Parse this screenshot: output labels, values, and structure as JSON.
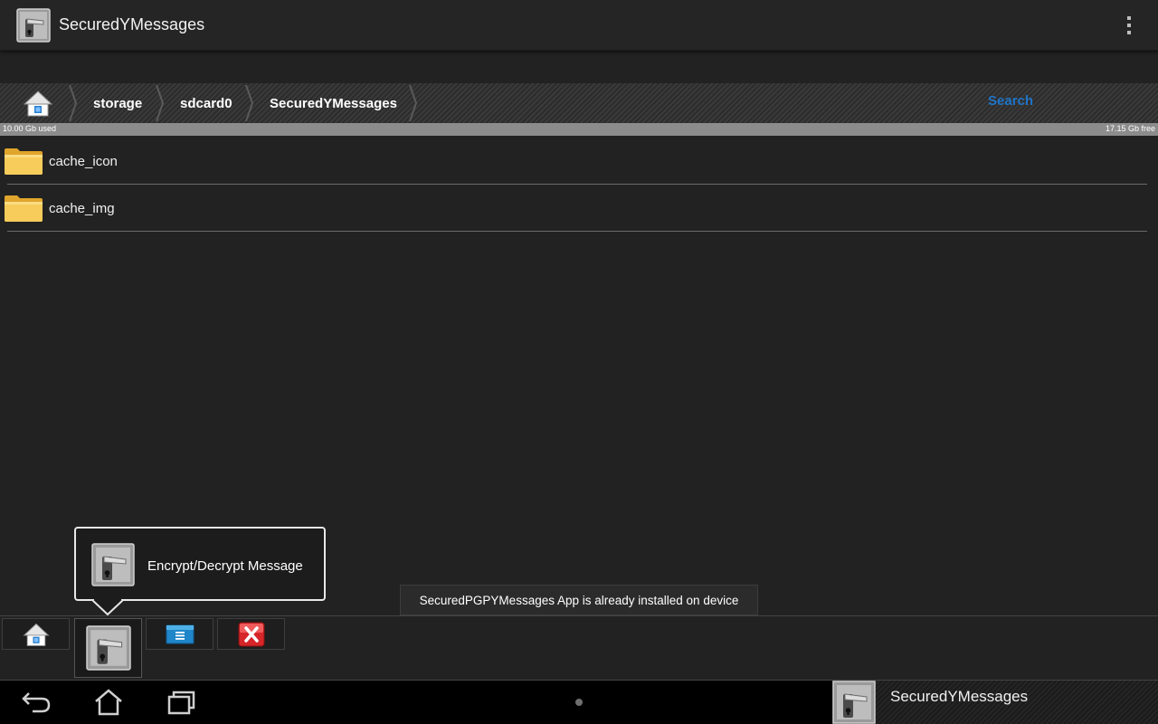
{
  "app": {
    "title": "SecuredYMessages",
    "icon": "lock-key-icon"
  },
  "action_bar": {
    "overflow_icon": "overflow-menu-icon"
  },
  "breadcrumb": {
    "home_icon": "home-icon",
    "items": [
      "storage",
      "sdcard0",
      "SecuredYMessages"
    ],
    "search_label": "Search",
    "accent": "#1f74c7"
  },
  "storage": {
    "used": "10.00 Gb used",
    "free": "17.15 Gb free"
  },
  "files": [
    {
      "name": "cache_icon",
      "icon": "folder-icon"
    },
    {
      "name": "cache_img",
      "icon": "folder-icon"
    }
  ],
  "popup": {
    "label": "Encrypt/Decrypt Message",
    "icon": "lock-key-icon"
  },
  "toast": {
    "message": "SecuredPGPYMessages App is already installed on device"
  },
  "toolbar": {
    "buttons": [
      {
        "name": "home",
        "icon": "home-icon"
      },
      {
        "name": "encrypt-decrypt",
        "icon": "lock-key-icon",
        "active": true
      },
      {
        "name": "notes",
        "icon": "document-icon"
      },
      {
        "name": "close",
        "icon": "close-icon"
      }
    ]
  },
  "system_nav": {
    "back_icon": "back-icon",
    "home_icon": "home-outline-icon",
    "recents_icon": "recent-apps-icon",
    "active_app": "SecuredYMessages"
  }
}
